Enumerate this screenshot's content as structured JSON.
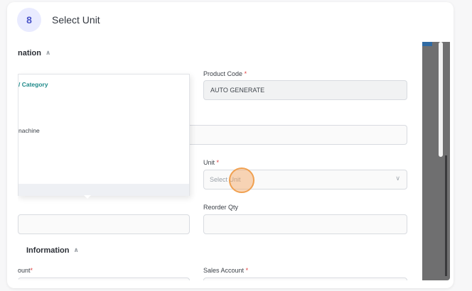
{
  "step": {
    "number": "8",
    "title": "Select Unit"
  },
  "form": {
    "section1_title": "nation",
    "product_code": {
      "label": "Product Code",
      "value": "AUTO GENERATE"
    },
    "dropdown_items": [
      "/ Category",
      "nachine"
    ],
    "unit": {
      "label": "Unit",
      "placeholder": "Select Unit"
    },
    "reorder_qty": {
      "label": "Reorder Qty"
    },
    "section2_title": "Information",
    "left_account_label": "ount",
    "sales_account": {
      "label": "Sales Account"
    },
    "required_mark": "*"
  },
  "icons": {
    "chevron_up": "∧",
    "chevron_down": "∨"
  },
  "colors": {
    "badge_bg": "#e9ebff",
    "badge_text": "#4b55c8",
    "accent": "#1f8a8a",
    "required": "#e03e3e",
    "click_ring": "#f0a050"
  }
}
